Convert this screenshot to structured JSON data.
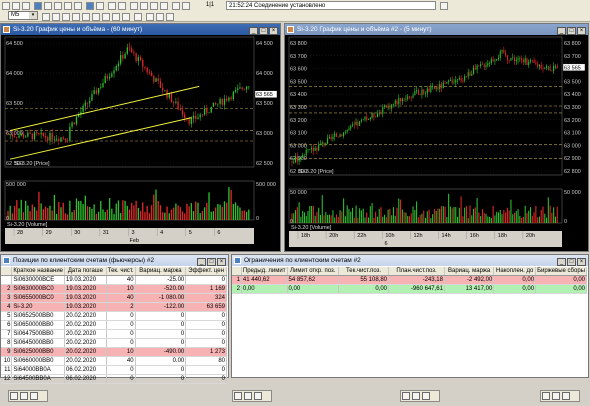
{
  "toolbar": {
    "page_indicator": "1|1",
    "status_time": "21:52:24",
    "status_text": "Соединение установлено",
    "interval_value": "M5"
  },
  "chart1": {
    "title": "Si-3.20 График цены и объёма - (60 минут)",
    "price_axis": [
      "64 500",
      "64 000",
      "63 500",
      "63 000",
      "62 500"
    ],
    "current_price": "63 565",
    "price_legend": "Si-3.20 [Price]",
    "volume_axis": [
      "500 000",
      "0"
    ],
    "volume_legend": "Si-3.20 [Volume]",
    "dates": [
      "28",
      "29",
      "30",
      "31",
      "3",
      "4",
      "5",
      "6"
    ],
    "month": "Feb"
  },
  "chart2": {
    "title": "Si-3.20 График цены и объёма #2 - (5 минут)",
    "price_axis": [
      "63 800",
      "63 700",
      "63 600",
      "63 500",
      "63 400",
      "63 300",
      "63 200",
      "63 100",
      "63 000",
      "62 900",
      "62 800"
    ],
    "current_price": "63 565",
    "price_legend": "Si-3.20 [Price]",
    "volume_axis": [
      "50 000",
      "0"
    ],
    "volume_legend": "Si-3.20 [Volume]",
    "times": [
      "18h",
      "20h",
      "22h",
      "10h",
      "12h",
      "14h",
      "16h",
      "18h",
      "20h"
    ],
    "day": "6"
  },
  "positions": {
    "title": "Позиции по клиентским счетам (фьючерсы) #2",
    "columns": [
      "",
      "Краткое название",
      "Дата погаше",
      "Тек. чист.",
      "Вариац. маржа",
      "Эффект. цен"
    ],
    "rows": [
      [
        "",
        "Si0630000ВСЕ",
        "19.03.2020",
        "40",
        "-25.00",
        "0"
      ],
      [
        "2",
        "Si0630000BC0",
        "19.03.2020",
        "10",
        "-520.00",
        "1 169"
      ],
      [
        "3",
        "Si0655000BC0",
        "19.03.2020",
        "40",
        "-1 080.00",
        "324"
      ],
      [
        "4",
        "Si-3.20",
        "19.03.2020",
        "2",
        "-122.00",
        "63 659"
      ],
      [
        "5",
        "Si0652500BB0",
        "20.02.2020",
        "0",
        "0",
        "0"
      ],
      [
        "6",
        "Si0650000BB0",
        "20.02.2020",
        "0",
        "0",
        "0"
      ],
      [
        "7",
        "Si0647500BB0",
        "20.02.2020",
        "0",
        "0",
        "0"
      ],
      [
        "8",
        "Si0645000BB0",
        "20.02.2020",
        "0",
        "0",
        "0"
      ],
      [
        "9",
        "Si0625000BB0",
        "20.02.2020",
        "10",
        "-490.00",
        "1 273"
      ],
      [
        "10",
        "Si0660000BB0",
        "20.02.2020",
        "40",
        "0.00",
        "80"
      ],
      [
        "11",
        "Si64000BB0A",
        "06.02.2020",
        "0",
        "0",
        "0"
      ],
      [
        "12",
        "Si64500BB0A",
        "06.02.2020",
        "0",
        "0",
        "0"
      ]
    ]
  },
  "limits": {
    "title": "Ограничения по клиентским счетам #2",
    "columns": [
      "",
      "Предыд. лимит",
      "Лимит откр. поз.",
      "Тек.чист.поз.",
      "План.чист.поз.",
      "Вариац. маржа",
      "Накоплен. до",
      "Биржевые сборы"
    ],
    "rows": [
      [
        "1",
        "41 440,62",
        "54 857,62",
        "55 108,80",
        "-243,18",
        "-2 492,00",
        "0,00",
        "0,00"
      ],
      [
        "2",
        "0,00",
        "0,00",
        "0,00",
        "-960 647,61",
        "13 417,00",
        "0,00",
        "0,00"
      ]
    ]
  },
  "colors": {
    "up_candle": "#2ec02e",
    "down_candle": "#e02828",
    "trendline": "#f0f040",
    "level_line": "#c0a050",
    "row_red": "#f7b3b3",
    "row_green": "#b3f0b3"
  }
}
